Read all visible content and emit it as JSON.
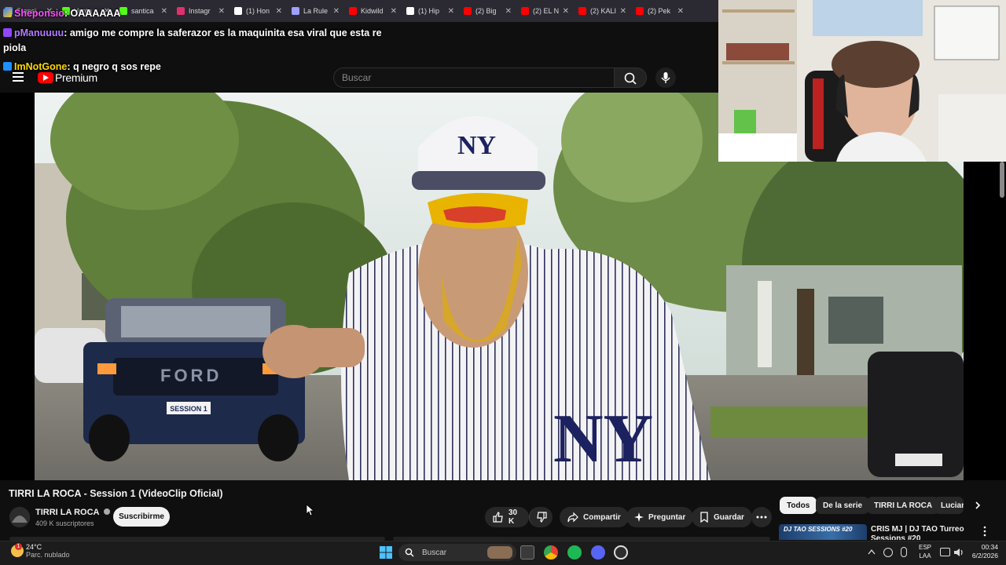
{
  "browser": {
    "tabs": [
      {
        "label": "Franci",
        "color": "#5b8def"
      },
      {
        "label": "Venta",
        "color": "#53fc18"
      },
      {
        "label": "santica",
        "color": "#53fc18"
      },
      {
        "label": "Instagr",
        "color": "#e1306c"
      },
      {
        "label": "(1) Hon",
        "color": "#ffffff"
      },
      {
        "label": "La Rule",
        "color": "#a0a0ff"
      },
      {
        "label": "Kidwild",
        "color": "#ff0000"
      },
      {
        "label": "(1) Hip",
        "color": "#ffffff"
      },
      {
        "label": "(2) Big",
        "color": "#ff0000"
      },
      {
        "label": "(2) EL N",
        "color": "#ff0000"
      },
      {
        "label": "(2) KALI",
        "color": "#ff0000"
      },
      {
        "label": "(2) Pek",
        "color": "#ff0000"
      }
    ]
  },
  "chat": [
    {
      "user": "Sheponsio",
      "user_color": "#ff4fff",
      "text": ": OAAAAAA"
    },
    {
      "user": "pManuuuu",
      "user_color": "#b27bff",
      "text": ": amigo me compre la saferazor es la maquinita esa viral que esta re"
    },
    {
      "user": "",
      "user_color": "#ffffff",
      "text": "piola"
    },
    {
      "user": "ImNotGone",
      "user_color": "#ffd700",
      "text": ": q negro q sos repe"
    }
  ],
  "youtube": {
    "logo_text": "Premium",
    "search_placeholder": "Buscar",
    "video_title": "TIRRI LA ROCA - Session 1 (VideoClip Oficial)",
    "channel_name": "TIRRI LA ROCA",
    "subscribers": "409 K suscriptores",
    "subscribe_label": "Suscribirme",
    "like_count": "30 K",
    "share_label": "Compartir",
    "ask_label": "Preguntar",
    "save_label": "Guardar",
    "chips": [
      "Todos",
      "De la serie",
      "TIRRI LA ROCA",
      "Lucian"
    ],
    "recommended": {
      "thumb_text": "DJ TAO SESSIONS #20",
      "title": "CRIS MJ | DJ TAO Turreo Sessions #20"
    },
    "plate_text": "SESSION 1",
    "cap_logo": "NY"
  },
  "taskbar": {
    "temperature": "24°C",
    "weather": "Parc. nublado",
    "search_label": "Buscar",
    "lang_top": "ESP",
    "lang_bottom": "LAA",
    "time": "00:34",
    "date": "6/2/2026",
    "notification_count": "1"
  }
}
